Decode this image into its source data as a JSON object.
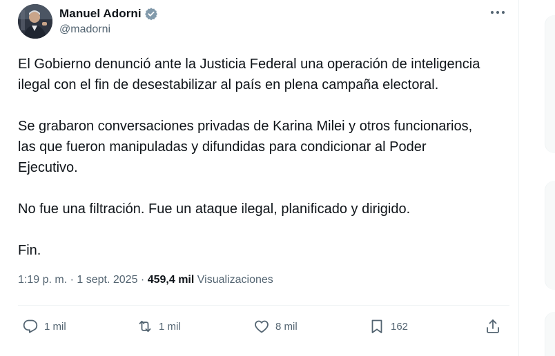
{
  "author": {
    "display_name": "Manuel Adorni",
    "handle": "@madorni",
    "verified": true,
    "verified_color": "#829aab"
  },
  "tweet": {
    "paragraphs": [
      "El Gobierno denunció ante la Justicia Federal una operación de inteligencia\nilegal con el fin de desestabilizar al país en plena campaña electoral.",
      "Se grabaron conversaciones privadas de Karina Milei y otros funcionarios,\nlas que fueron manipuladas y difundidas para condicionar al Poder\nEjecutivo.",
      "No fue una filtración. Fue un ataque ilegal, planificado y dirigido.",
      "Fin."
    ],
    "time": "1:19 p. m.",
    "separator": "·",
    "date": "1 sept. 2025",
    "views_count": "459,4 mil",
    "views_label": "Visualizaciones"
  },
  "actions": {
    "reply": {
      "icon": "reply-icon",
      "count": "1 mil"
    },
    "retweet": {
      "icon": "retweet-icon",
      "count": "1 mil"
    },
    "like": {
      "icon": "heart-icon",
      "count": "8 mil"
    },
    "bookmark": {
      "icon": "bookmark-icon",
      "count": "162"
    },
    "share": {
      "icon": "share-icon"
    }
  },
  "more_menu_icon": "more-icon"
}
